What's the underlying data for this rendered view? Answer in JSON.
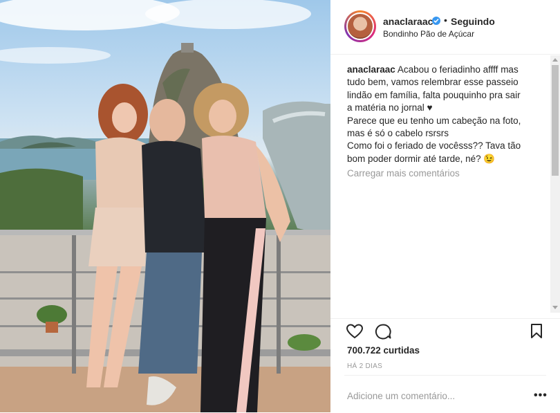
{
  "photo": {
    "alt": "",
    "colors": {
      "sky": "#9fc8ea",
      "sea": "#7aa6b8",
      "shorts": "#e8c9b4",
      "shirt": "#25282e",
      "top": "#e9bfae",
      "pants": "#1f1e22"
    }
  },
  "header": {
    "username": "anaclaraac",
    "verified": true,
    "separator": "•",
    "follow_status": "Seguindo",
    "location": "Bondinho Pão de Açúcar"
  },
  "caption": {
    "user": "anaclaraac",
    "text": " Acabou o feriadinho affff mas\ntudo bem, vamos relembrar esse passeio\nlindão em família, falta pouquinho pra sair\na matéria no jornal ♥\nParece que eu tenho um cabeção na foto,\nmas é só o cabelo rsrsrs\nComo foi o feriado de vocêsss?? Tava tão\nbom poder dormir até tarde, né? 😉"
  },
  "load_more": "Carregar mais comentários",
  "actions": {
    "like_icon": "heart-icon",
    "comment_icon": "comment-icon",
    "save_icon": "bookmark-icon"
  },
  "likes": "700.722 curtidas",
  "time_ago": "HÁ 2 DIAS",
  "comment_input": {
    "placeholder": "Adicione um comentário..."
  },
  "more_options": "•••"
}
